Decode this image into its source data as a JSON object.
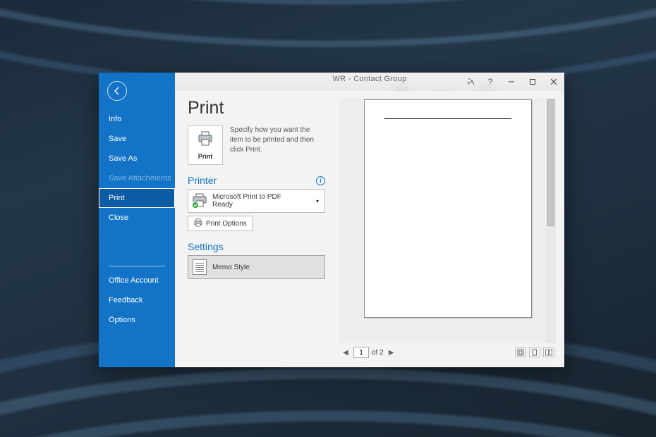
{
  "window": {
    "title": "WR  -  Contact Group"
  },
  "sidebar": {
    "items": [
      {
        "label": "Info",
        "key": "info"
      },
      {
        "label": "Save",
        "key": "save"
      },
      {
        "label": "Save As",
        "key": "saveas"
      },
      {
        "label": "Save Attachments",
        "key": "saveatt",
        "disabled": true
      },
      {
        "label": "Print",
        "key": "print",
        "selected": true
      },
      {
        "label": "Close",
        "key": "close"
      }
    ],
    "bottom": [
      {
        "label": "Office Account",
        "key": "account"
      },
      {
        "label": "Feedback",
        "key": "feedback"
      },
      {
        "label": "Options",
        "key": "options"
      }
    ]
  },
  "page": {
    "title": "Print",
    "print_tile_label": "Print",
    "help_text": "Specify how you want the item to be printed and then click Print.",
    "printer_section": "Printer",
    "printer_name": "Microsoft Print to PDF",
    "printer_status": "Ready",
    "print_options_label": "Print Options",
    "settings_section": "Settings",
    "style_label": "Memo Style"
  },
  "pager": {
    "current": "1",
    "total_label": "of 2"
  }
}
